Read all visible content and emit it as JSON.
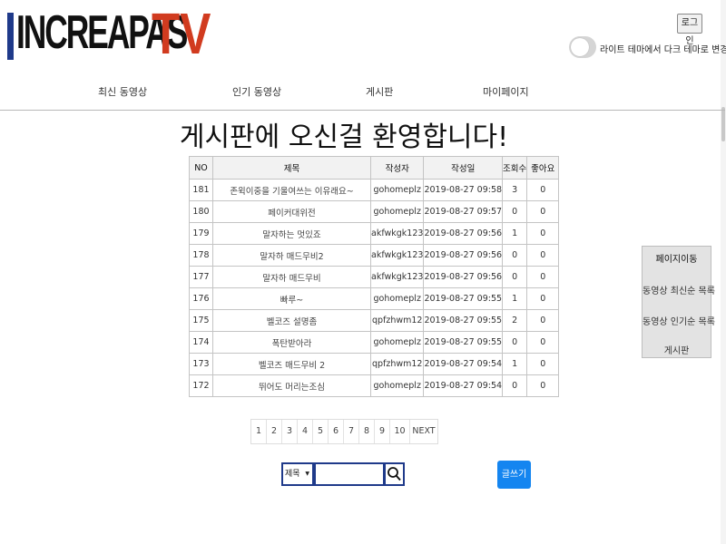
{
  "brand": {
    "logo_main": "INCREAPAS",
    "logo_tv": "TV",
    "accent": "#d13b1f",
    "bar_color": "#1f3a8a"
  },
  "header": {
    "login_label": "로그인",
    "theme_toggle_label": "라이트 테마에서 다크 테마로 변경",
    "theme_on": false
  },
  "nav": {
    "items": [
      "최신 동영상",
      "인기 동영상",
      "게시판",
      "마이페이지"
    ]
  },
  "page": {
    "title": "게시판에 오신걸 환영합니다!"
  },
  "table": {
    "headers": [
      "NO",
      "제목",
      "작성자",
      "작성일",
      "조회수",
      "좋아요"
    ],
    "rows": [
      [
        "181",
        "존윅이중을 기울여쓰는 이유래요~",
        "gohomeplz",
        "2019-08-27 09:58",
        "3",
        "0"
      ],
      [
        "180",
        "페이커대위전",
        "gohomeplz",
        "2019-08-27 09:57",
        "0",
        "0"
      ],
      [
        "179",
        "말자하는 멋있죠",
        "akfwkgk123",
        "2019-08-27 09:56",
        "1",
        "0"
      ],
      [
        "178",
        "말자하 매드무비2",
        "akfwkgk123",
        "2019-08-27 09:56",
        "0",
        "0"
      ],
      [
        "177",
        "말자하 매드무비",
        "akfwkgk123",
        "2019-08-27 09:56",
        "0",
        "0"
      ],
      [
        "176",
        "빠루~",
        "gohomeplz",
        "2019-08-27 09:55",
        "1",
        "0"
      ],
      [
        "175",
        "벨코즈 설명좀",
        "qpfzhwm12",
        "2019-08-27 09:55",
        "2",
        "0"
      ],
      [
        "174",
        "폭탄받아라",
        "gohomeplz",
        "2019-08-27 09:55",
        "0",
        "0"
      ],
      [
        "173",
        "벨코즈 매드무비 2",
        "qpfzhwm12",
        "2019-08-27 09:54",
        "1",
        "0"
      ],
      [
        "172",
        "뛰어도 머리는조심",
        "gohomeplz",
        "2019-08-27 09:54",
        "0",
        "0"
      ]
    ]
  },
  "pagination": {
    "pages": [
      "1",
      "2",
      "3",
      "4",
      "5",
      "6",
      "7",
      "8",
      "9",
      "10",
      "NEXT"
    ]
  },
  "search": {
    "select_value": "제목",
    "query": "",
    "button_icon": "search-icon"
  },
  "write_label": "글쓰기",
  "side_nav": {
    "title": "페이지이동",
    "items": [
      "동영상 최신순 목록",
      "동영상 인기순 목록",
      "게시판"
    ]
  },
  "colors": {
    "primary_button": "#1485f0",
    "search_border": "#1f3a8a"
  }
}
